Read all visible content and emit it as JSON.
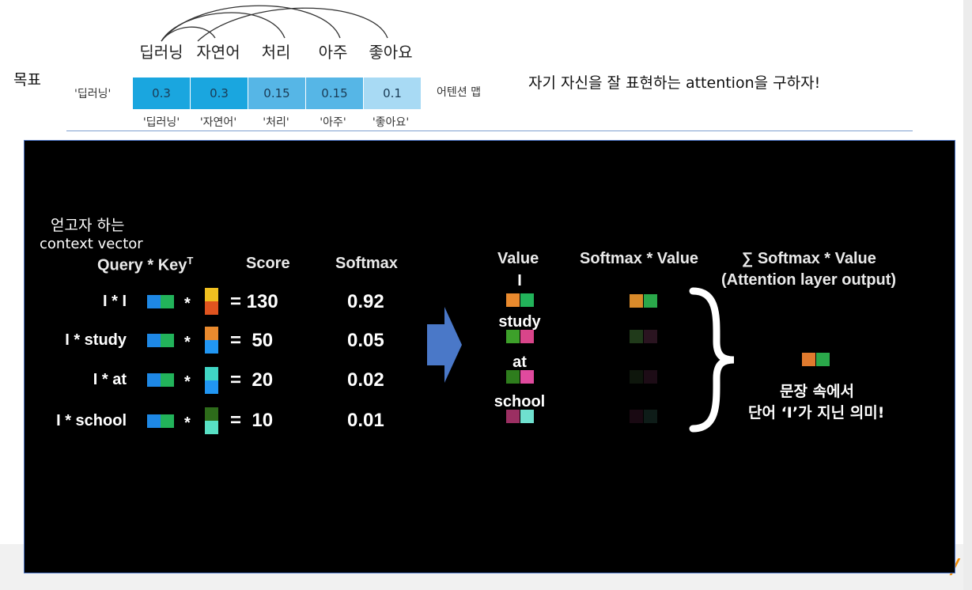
{
  "goal_label": "목표",
  "top_words": [
    "딥러닝",
    "자연어",
    "처리",
    "아주",
    "좋아요"
  ],
  "attention_row_label": "'딥러닝'",
  "attention_values": [
    "0.3",
    "0.3",
    "0.15",
    "0.15",
    "0.1"
  ],
  "attention_colors": [
    "#1aa6df",
    "#1aa6df",
    "#56b6e6",
    "#56b6e6",
    "#a8daf4"
  ],
  "bottom_words": [
    "'딥러닝'",
    "'자연어'",
    "'처리'",
    "'아주'",
    "'좋아요'"
  ],
  "attention_map_label": "어텐션 맵",
  "goal_text": "자기 자신을 잘 표현하는 attention을 구하자!",
  "panel": {
    "context_line1": "얻고자 하는",
    "context_line2": "context vector",
    "headers": {
      "query_key": "Query * Key",
      "query_key_sup": "T",
      "score": "Score",
      "softmax": "Softmax",
      "value": "Value",
      "softmax_value": "Softmax * Value",
      "sum_line1": "∑ Softmax * Value",
      "sum_line2": "(Attention layer output)"
    },
    "rows": [
      {
        "label": "I * I",
        "op": "*",
        "eq": "= 130",
        "softmax": "0.92"
      },
      {
        "label": "I * study",
        "op": "*",
        "eq": "=  50",
        "softmax": "0.05"
      },
      {
        "label": "I * at",
        "op": "*",
        "eq": "=  20",
        "softmax": "0.02"
      },
      {
        "label": "I * school",
        "op": "*",
        "eq": "=  10",
        "softmax": "0.01"
      }
    ],
    "value_words": [
      "I",
      "study",
      "at",
      "school"
    ],
    "result_line1": "문장 속에서",
    "result_line2": "단어 ‘I’가 지닌 의미!",
    "colors": {
      "query_a": "#1e88e5",
      "query_b": "#22b35a",
      "arrow": "#4a78c8"
    }
  }
}
